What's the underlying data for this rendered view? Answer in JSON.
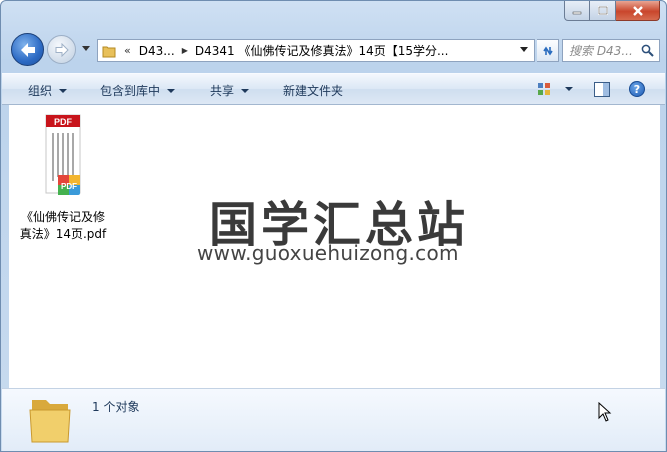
{
  "window": {
    "caption_buttons": [
      "minimize",
      "maximize",
      "close"
    ]
  },
  "nav": {
    "breadcrumb_overflow": "«",
    "crumbs": [
      "D43...",
      "D4341 《仙佛传记及修真法》14页【15学分..."
    ],
    "search_placeholder": "搜索 D43..."
  },
  "toolbar": {
    "organize": "组织",
    "include_in_library": "包含到库中",
    "share": "共享",
    "new_folder": "新建文件夹"
  },
  "files": [
    {
      "name_line1": "《仙佛传记及修",
      "name_line2": "真法》14页.pdf",
      "icon": "pdf-file-icon",
      "badge": "PDF",
      "corner_badge": "PDF"
    }
  ],
  "watermark": {
    "title": "国学汇总站",
    "url": "www.guoxuehuizong.com"
  },
  "details": {
    "count_text": "1 个对象"
  },
  "colors": {
    "window_frame": "#bcd3ec",
    "close_button": "#c9462c",
    "pdf_red": "#c8141b"
  }
}
